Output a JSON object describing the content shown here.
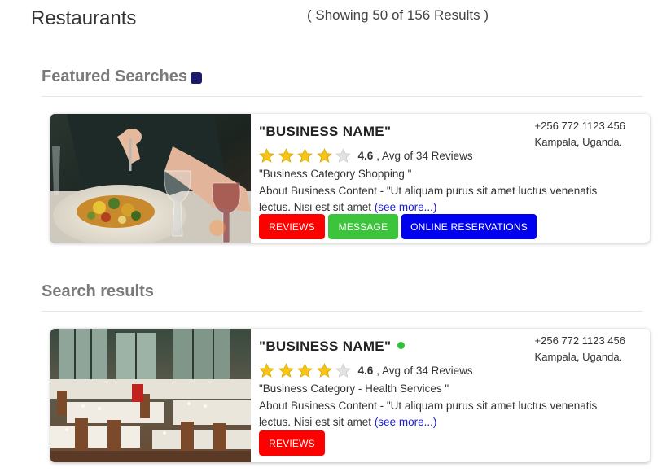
{
  "page": {
    "title": "Restaurants",
    "results_count": "( Showing 50 of 156 Results )"
  },
  "featured": {
    "heading": "Featured Searches",
    "cards": [
      {
        "name": "\"BUSINESS NAME\"",
        "phone": "+256 772 1123 456",
        "location": "Kampala, Uganda.",
        "rating": 4.6,
        "rating_label": "4.6",
        "reviews_text": ", Avg of 34 Reviews",
        "category": "\"Business Category Shopping \"",
        "about": "About Business Content - \"Ut aliquam purus sit amet luctus venenatis lectus. Nisi est sit amet",
        "see_more": "(see more...)",
        "buttons": {
          "reviews": "REVIEWS",
          "message": "MESSAGE",
          "reservations": "ONLINE RESERVATIONS"
        },
        "photo": "food-plate-photo"
      }
    ]
  },
  "search": {
    "heading": "Search results",
    "cards": [
      {
        "name": "\"BUSINESS NAME\"",
        "online": true,
        "phone": "+256 772 1123 456",
        "location": "Kampala, Uganda.",
        "rating": 4.6,
        "rating_label": "4.6",
        "reviews_text": ", Avg of 34 Reviews",
        "category": "\"Business Category - Health Services \"",
        "about": "About Business Content - \"Ut aliquam purus sit amet luctus venenatis lectus. Nisi est sit amet",
        "see_more": "(see more...)",
        "buttons": {
          "reviews": "REVIEWS"
        },
        "photo": "restaurant-interior-photo"
      }
    ]
  },
  "colors": {
    "reviews_button": "#ff0000",
    "message_button": "#3dc43d",
    "reservations_button": "#0000f0",
    "online_indicator": "#2ec23a",
    "link": "#1a1ad8",
    "featured_marker": "#1b1b6b"
  }
}
